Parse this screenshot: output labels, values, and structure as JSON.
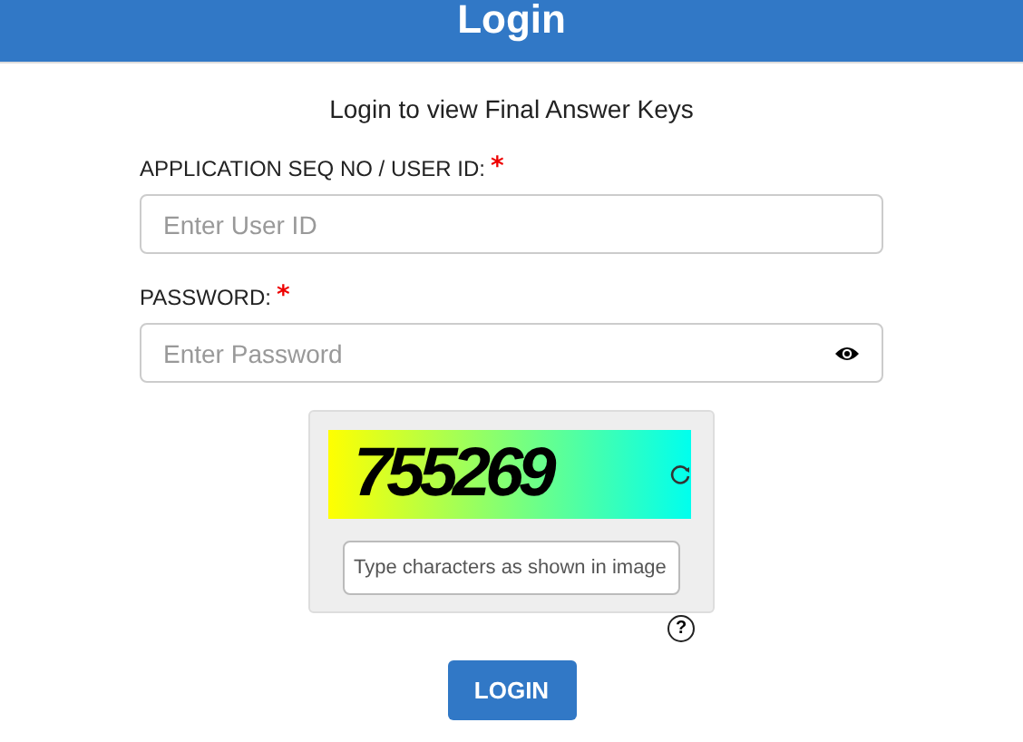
{
  "header": {
    "title": "Login"
  },
  "subtitle": "Login to view Final Answer Keys",
  "fields": [
    {
      "label": "APPLICATION SEQ NO / USER ID:",
      "required_mark": "*",
      "placeholder": "Enter User ID",
      "kind": "text"
    },
    {
      "label": "PASSWORD:",
      "required_mark": "*",
      "placeholder": "Enter Password",
      "kind": "password"
    }
  ],
  "captcha": {
    "code": "755269",
    "placeholder": "Type characters as shown in image",
    "help": "?"
  },
  "button": "LOGIN"
}
